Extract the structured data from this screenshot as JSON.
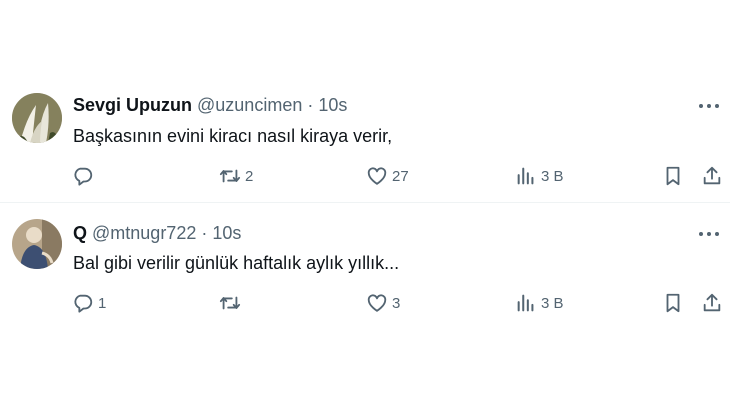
{
  "tweets": [
    {
      "display_name": "Sevgi Upuzun",
      "handle": "@uzuncimen",
      "separator": "·",
      "time": "10s",
      "text": "Başkasının evini kiracı nasıl kiraya verir,",
      "reply_count": "",
      "retweet_count": "2",
      "like_count": "27",
      "view_count": "3 B",
      "avatar": "lily-flower-photo"
    },
    {
      "display_name": "Q",
      "handle": "@mtnugr722",
      "separator": "·",
      "time": "10s",
      "text": "Bal gibi verilir günlük haftalık aylık yıllık...",
      "reply_count": "1",
      "retweet_count": "",
      "like_count": "3",
      "view_count": "3 B",
      "avatar": "person-photo"
    }
  ],
  "icons": {
    "reply": "reply-icon",
    "retweet": "retweet-icon",
    "like": "heart-icon",
    "views": "analytics-icon",
    "bookmark": "bookmark-icon",
    "share": "share-icon",
    "more": "more-icon"
  },
  "colors": {
    "text_primary": "#0f1419",
    "text_secondary": "#536471",
    "divider": "#eff3f4"
  }
}
